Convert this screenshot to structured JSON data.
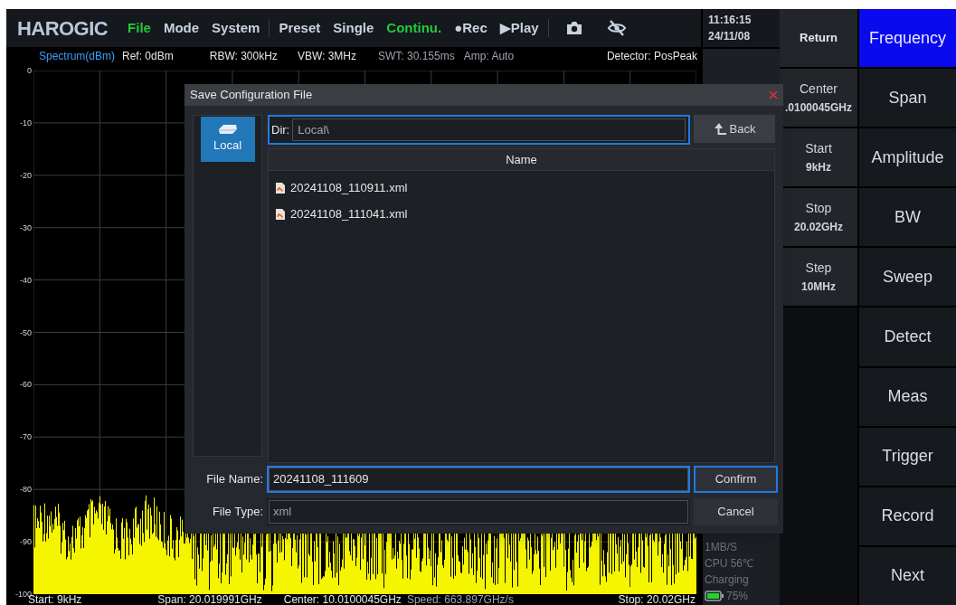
{
  "menu_bar": {
    "logo": "HAROGIC",
    "items": [
      {
        "label": "File",
        "active": true,
        "separator_after": false
      },
      {
        "label": "Mode",
        "active": false,
        "separator_after": false
      },
      {
        "label": "System",
        "active": false,
        "separator_after": true
      },
      {
        "label": "Preset",
        "active": false,
        "separator_after": false
      },
      {
        "label": "Single",
        "active": false,
        "separator_after": false
      },
      {
        "label": "Continu.",
        "active": true,
        "separator_after": false
      },
      {
        "label": "●Rec",
        "active": false,
        "separator_after": false
      },
      {
        "label": "▶Play",
        "active": false,
        "separator_after": true
      }
    ]
  },
  "info_row": [
    {
      "text": "Spectrum(dBm)",
      "color": "#3b9ef5"
    },
    {
      "text": "Ref: 0dBm",
      "color": "#e5e7eb"
    },
    {
      "text": "RBW: 300kHz",
      "color": "#e5e7eb"
    },
    {
      "text": "VBW: 3MHz",
      "color": "#e5e7eb"
    },
    {
      "text": "SWT: 30.155ms",
      "color": "#9ca3af"
    },
    {
      "text": "Amp: Auto",
      "color": "#9ca3af"
    },
    {
      "text": "Detector: PosPeak",
      "color": "#e5e7eb"
    }
  ],
  "y_axis_labels": [
    "0",
    "-10",
    "-20",
    "-30",
    "-40",
    "-50",
    "-60",
    "-70",
    "-80",
    "-90",
    "-100"
  ],
  "bottom_row": [
    {
      "text": "Start: 9kHz",
      "color": "#e5e7eb"
    },
    {
      "text": "Span: 20.019991GHz",
      "color": "#e5e7eb"
    },
    {
      "text": "Center: 10.0100045GHz",
      "color": "#e5e7eb"
    },
    {
      "text": "Speed: 663.897GHz/s",
      "color": "#9ca3af"
    },
    {
      "text": "Stop: 20.02GHz",
      "color": "#e5e7eb"
    }
  ],
  "clock": {
    "time": "11:16:15",
    "date": "24/11/08"
  },
  "status": {
    "rate": "1MB/S",
    "cpu": "CPU 56℃",
    "power": "Charging",
    "battery": "75%"
  },
  "sub_menu": {
    "return": "Return",
    "items": [
      {
        "label": "Center",
        "value": ".0100045GHz"
      },
      {
        "label": "Start",
        "value": "9kHz"
      },
      {
        "label": "Stop",
        "value": "20.02GHz"
      },
      {
        "label": "Step",
        "value": "10MHz"
      }
    ]
  },
  "main_menu": [
    {
      "label": "Frequency",
      "selected": true
    },
    {
      "label": "Span",
      "selected": false
    },
    {
      "label": "Amplitude",
      "selected": false
    },
    {
      "label": "BW",
      "selected": false
    },
    {
      "label": "Sweep",
      "selected": false
    },
    {
      "label": "Detect",
      "selected": false
    },
    {
      "label": "Meas",
      "selected": false
    },
    {
      "label": "Trigger",
      "selected": false
    },
    {
      "label": "Record",
      "selected": false
    },
    {
      "label": "Next",
      "selected": false
    }
  ],
  "dialog": {
    "title": "Save Configuration File",
    "locations": [
      {
        "label": "Local",
        "selected": true
      }
    ],
    "dir": {
      "label": "Dir:",
      "value": "Local\\",
      "focused": true
    },
    "back_button": "Back",
    "file_list": {
      "columns": [
        "Name"
      ],
      "rows": [
        "20241108_110911.xml",
        "20241108_111041.xml"
      ]
    },
    "file_name": {
      "label": "File Name:",
      "value": "20241108_111609",
      "focused": true
    },
    "file_type": {
      "label": "File Type:",
      "value": "xml",
      "focused": false
    },
    "buttons": [
      {
        "label": "Confirm",
        "focused": true
      },
      {
        "label": "Cancel",
        "focused": false
      }
    ]
  }
}
